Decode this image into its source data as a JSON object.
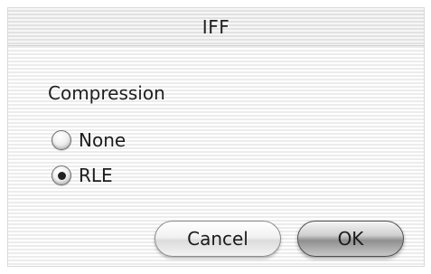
{
  "dialog": {
    "title": "IFF",
    "section_label": "Compression",
    "options": [
      {
        "label": "None",
        "selected": false
      },
      {
        "label": "RLE",
        "selected": true
      }
    ],
    "buttons": {
      "cancel_label": "Cancel",
      "ok_label": "OK"
    }
  }
}
